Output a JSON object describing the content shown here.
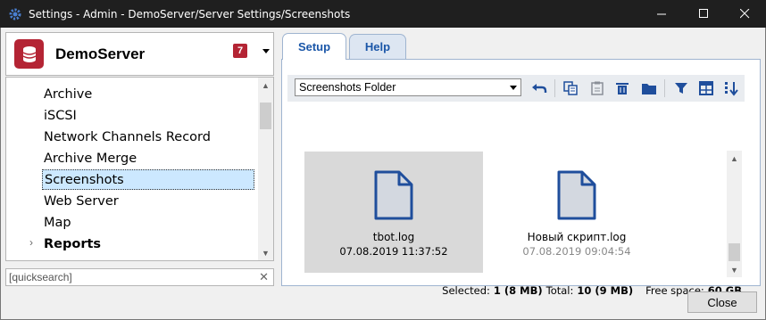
{
  "window": {
    "title": "Settings - Admin - DemoServer/Server Settings/Screenshots",
    "controls": {
      "minimize": "—",
      "maximize": "☐",
      "close": "✕"
    }
  },
  "server": {
    "name": "DemoServer",
    "badge": "7",
    "accent": "#b42434"
  },
  "tree": {
    "items": [
      {
        "label": "Archive",
        "selected": false,
        "bold": false
      },
      {
        "label": "iSCSI",
        "selected": false,
        "bold": false
      },
      {
        "label": "Network Channels Record",
        "selected": false,
        "bold": false
      },
      {
        "label": "Archive Merge",
        "selected": false,
        "bold": false
      },
      {
        "label": "Screenshots",
        "selected": true,
        "bold": false
      },
      {
        "label": "Web Server",
        "selected": false,
        "bold": false
      },
      {
        "label": "Map",
        "selected": false,
        "bold": false
      },
      {
        "label": "Reports",
        "selected": false,
        "bold": true
      }
    ],
    "expand_arrow": "›"
  },
  "quicksearch": {
    "value": "[quicksearch]",
    "clear": "✕"
  },
  "tabs": [
    {
      "label": "Setup",
      "active": true
    },
    {
      "label": "Help",
      "active": false
    }
  ],
  "toolbar": {
    "folder_select": "Screenshots Folder",
    "icons": [
      "back-icon",
      "copy-icon",
      "paste-icon",
      "delete-icon",
      "folder-icon",
      "filter-icon",
      "grid-view-icon",
      "sort-icon"
    ]
  },
  "files": [
    {
      "name": "tbot.log",
      "date": "07.08.2019 11:37:52",
      "selected": true
    },
    {
      "name": "Новый скрипт.log",
      "date": "07.08.2019 09:04:54",
      "selected": false
    }
  ],
  "status": {
    "selected_label": "Selected:",
    "selected_value": "1 (8 MB)",
    "total_label": "Total:",
    "total_value": "10 (9 MB)",
    "free_label": "Free space:",
    "free_value": "60 GB"
  },
  "buttons": {
    "close": "Close"
  },
  "colors": {
    "tab_text": "#1a56a8",
    "icon_blue": "#1f4e9c",
    "doc_fill": "#d3d8e0"
  }
}
